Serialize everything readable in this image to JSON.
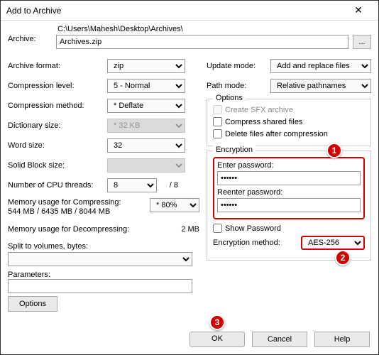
{
  "title": "Add to Archive",
  "archive": {
    "label": "Archive:",
    "path_dir": "C:\\Users\\Mahesh\\Desktop\\Archives\\",
    "filename": "Archives.zip",
    "browse": "..."
  },
  "left": {
    "format": {
      "label": "Archive format:",
      "value": "zip"
    },
    "level": {
      "label": "Compression level:",
      "value": "5 - Normal"
    },
    "method": {
      "label": "Compression method:",
      "value": "* Deflate"
    },
    "dict": {
      "label": "Dictionary size:",
      "value": "* 32 KB"
    },
    "word": {
      "label": "Word size:",
      "value": "32"
    },
    "block": {
      "label": "Solid Block size:",
      "value": ""
    },
    "threads": {
      "label": "Number of CPU threads:",
      "value": "8",
      "extra": "/ 8"
    },
    "mem_comp_label": "Memory usage for Compressing:",
    "mem_comp_info": "544 MB / 6435 MB / 8044 MB",
    "mem_comp_value": "* 80%",
    "mem_decomp_label": "Memory usage for Decompressing:",
    "mem_decomp_value": "2 MB",
    "split_label": "Split to volumes, bytes:",
    "split_value": "",
    "params_label": "Parameters:",
    "params_value": "",
    "options_btn": "Options"
  },
  "right": {
    "update": {
      "label": "Update mode:",
      "value": "Add and replace files"
    },
    "pathmode": {
      "label": "Path mode:",
      "value": "Relative pathnames"
    },
    "options_title": "Options",
    "opt_sfx": "Create SFX archive",
    "opt_shared": "Compress shared files",
    "opt_delete": "Delete files after compression",
    "enc_title": "Encryption",
    "enter_pw": "Enter password:",
    "pw_value": "******",
    "reenter_pw": "Reenter password:",
    "repw_value": "******",
    "show_pw": "Show Password",
    "enc_method_label": "Encryption method:",
    "enc_method_value": "AES-256"
  },
  "buttons": {
    "ok": "OK",
    "cancel": "Cancel",
    "help": "Help"
  },
  "badges": {
    "b1": "1",
    "b2": "2",
    "b3": "3"
  }
}
